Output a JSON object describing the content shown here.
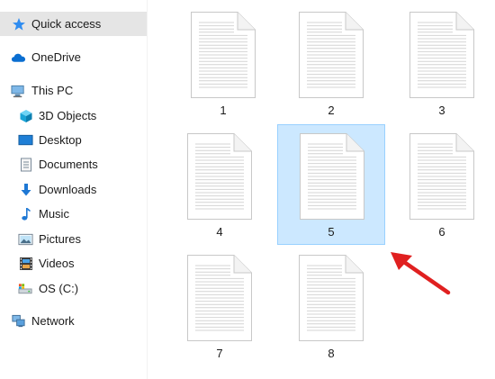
{
  "sidebar": {
    "items": [
      {
        "label": "Quick access",
        "icon": "star-icon",
        "selected": true
      },
      {
        "label": "OneDrive",
        "icon": "cloud-icon"
      },
      {
        "label": "This PC",
        "icon": "computer-icon"
      },
      {
        "label": "3D Objects",
        "icon": "cube-icon"
      },
      {
        "label": "Desktop",
        "icon": "desktop-icon"
      },
      {
        "label": "Documents",
        "icon": "documents-icon"
      },
      {
        "label": "Downloads",
        "icon": "download-arrow-icon"
      },
      {
        "label": "Music",
        "icon": "music-note-icon"
      },
      {
        "label": "Pictures",
        "icon": "pictures-icon"
      },
      {
        "label": "Videos",
        "icon": "film-icon"
      },
      {
        "label": "OS (C:)",
        "icon": "drive-icon"
      },
      {
        "label": "Network",
        "icon": "network-icon"
      }
    ]
  },
  "files": [
    {
      "name": "1"
    },
    {
      "name": "2"
    },
    {
      "name": "3"
    },
    {
      "name": "4"
    },
    {
      "name": "5",
      "selected": true
    },
    {
      "name": "6"
    },
    {
      "name": "7"
    },
    {
      "name": "8"
    }
  ],
  "annotation": {
    "icon": "red-arrow-icon",
    "color": "#e02020"
  },
  "colors": {
    "selection_fill": "#cce8ff",
    "selection_border": "#99d1ff",
    "sidebar_selected": "#e5e5e5",
    "folder_blue": "#1e90ff"
  }
}
